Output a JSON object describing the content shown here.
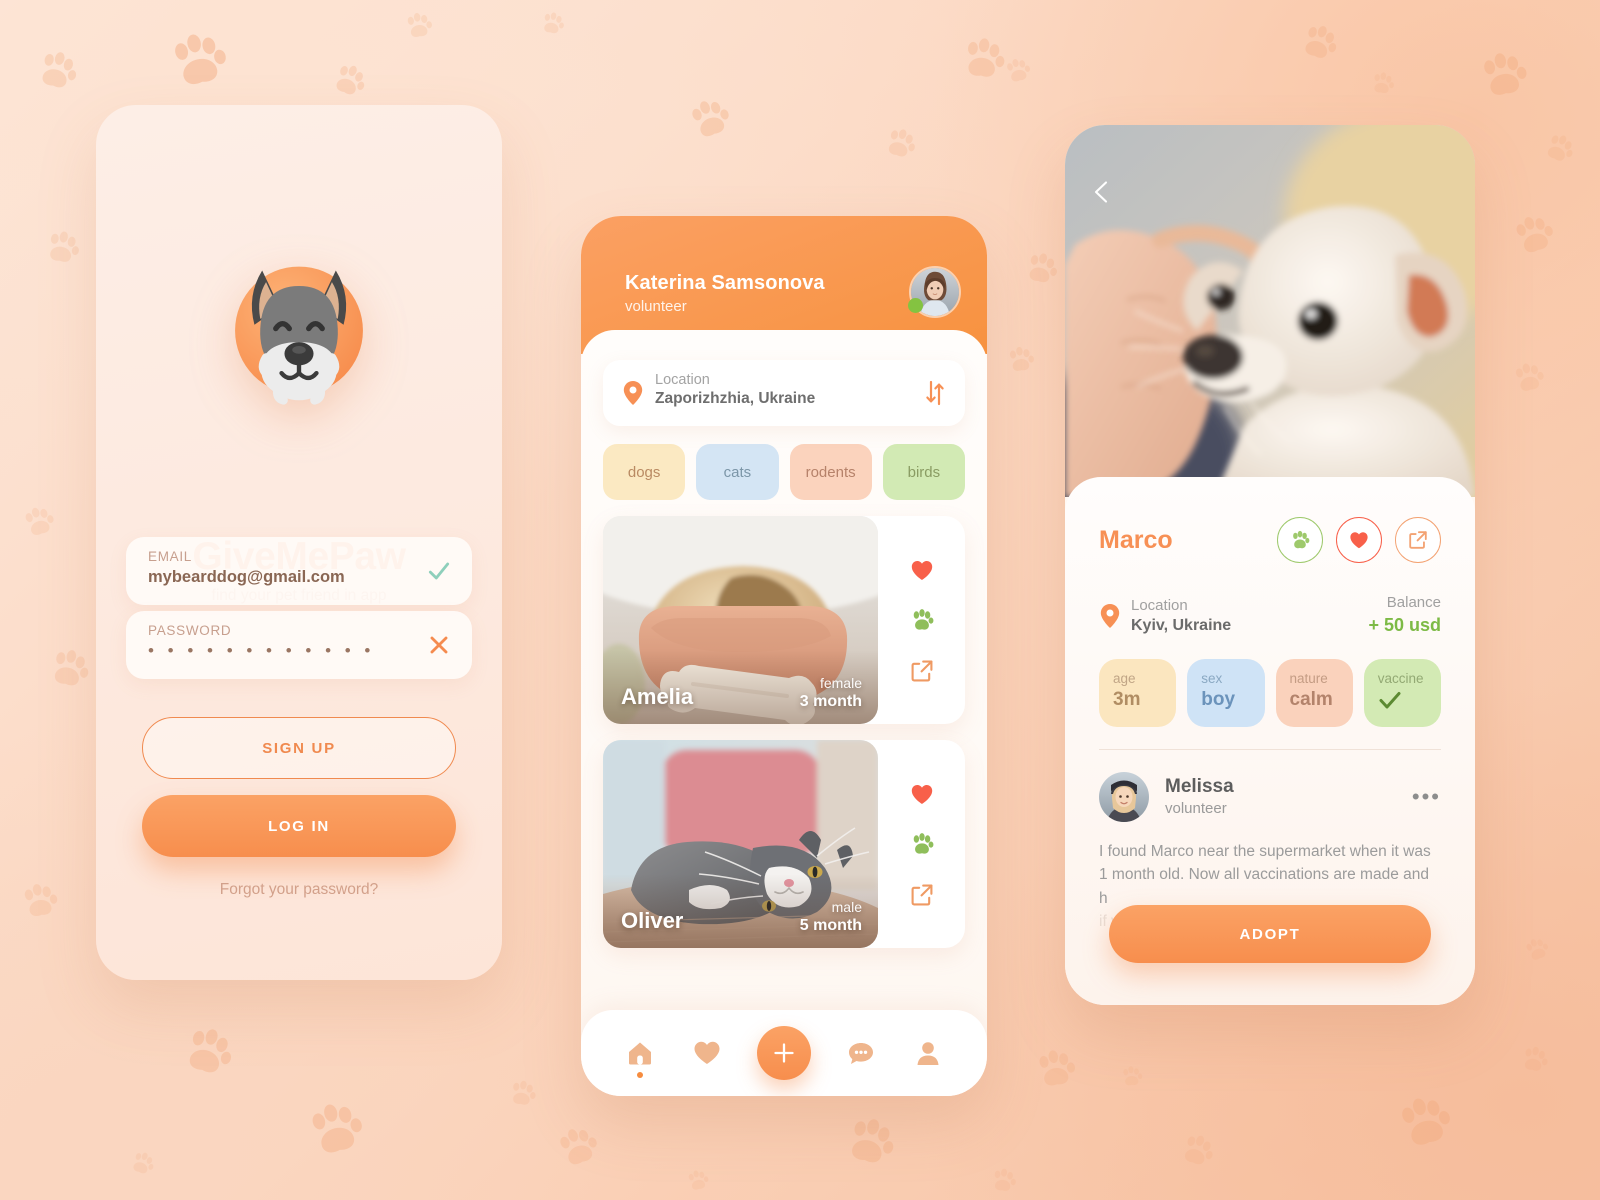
{
  "app": {
    "brand_name": "GiveMePaw",
    "tagline": "find your pet friend in app",
    "accent_color": "#f79055",
    "accent_dark": "#f78e4d",
    "background_color": "#fbd6bf"
  },
  "login_screen": {
    "logo_icon": "dog-face-logo-icon",
    "email_field": {
      "label": "EMAIL",
      "value": "mybearddog@gmail.com",
      "placeholder": "email",
      "status_icon": "check-icon",
      "status_color": "#8ecfbb"
    },
    "password_field": {
      "label": "PASSWORD",
      "value": "• • • • • • • • • • • •",
      "placeholder": "password",
      "status_icon": "close-icon",
      "status_color": "#f58b4f"
    },
    "signup_label": "SIGN UP",
    "login_label": "LOG IN",
    "forgot_label": "Forgot your password?"
  },
  "feed_screen": {
    "user": {
      "name": "Katerina Samsonova",
      "role": "volunteer",
      "online": true,
      "online_color": "#84c341"
    },
    "location": {
      "label": "Location",
      "value": "Zaporizhzhia, Ukraine",
      "pin_icon": "location-pin-icon",
      "sort_icon": "sort-filter-icon"
    },
    "categories": [
      {
        "label": "dogs",
        "bg": "#fbe9c2",
        "fg": "#b98a62"
      },
      {
        "label": "cats",
        "bg": "#d4e5f4",
        "fg": "#7c96a8"
      },
      {
        "label": "rodents",
        "bg": "#fbd3bd",
        "fg": "#b6826a"
      },
      {
        "label": "birds",
        "bg": "#d2eab4",
        "fg": "#8a9c63"
      }
    ],
    "pets": [
      {
        "name": "Amelia",
        "sex": "female",
        "age": "3 month",
        "photo": "pug-puppy-in-bowl-photo",
        "actions": [
          "heart-icon",
          "paw-icon",
          "share-icon"
        ]
      },
      {
        "name": "Oliver",
        "sex": "male",
        "age": "5 month",
        "photo": "grey-white-cat-photo",
        "actions": [
          "heart-icon",
          "paw-icon",
          "share-icon"
        ]
      }
    ],
    "tabbar": [
      {
        "icon": "home-icon",
        "label": "home",
        "active": true
      },
      {
        "icon": "heart-icon",
        "label": "favorites",
        "active": false
      },
      {
        "icon": "plus-icon",
        "label": "add",
        "active": false
      },
      {
        "icon": "chat-icon",
        "label": "messages",
        "active": false
      },
      {
        "icon": "profile-icon",
        "label": "profile",
        "active": false
      }
    ]
  },
  "detail_screen": {
    "back_icon": "chevron-left-icon",
    "hero_photo": "white-puppy-held-in-hand-photo",
    "pet_name": "Marco",
    "round_actions": [
      {
        "icon": "paw-icon",
        "color": "#9ec96c"
      },
      {
        "icon": "heart-icon",
        "color": "#f8604a"
      },
      {
        "icon": "share-icon",
        "color": "#f3a272"
      }
    ],
    "location": {
      "label": "Location",
      "value": "Kyiv, Ukraine",
      "pin_icon": "location-pin-icon"
    },
    "balance": {
      "label": "Balance",
      "value": "+ 50 usd",
      "color": "#7dba46"
    },
    "attributes": [
      {
        "label": "age",
        "value": "3m",
        "bg": "#fbe6bf",
        "fg": "#b08d63",
        "label_fg": "#c0a586"
      },
      {
        "label": "sex",
        "value": "boy",
        "bg": "#cfe3f6",
        "fg": "#6b93bb",
        "label_fg": "#8aa8c2"
      },
      {
        "label": "nature",
        "value": "calm",
        "bg": "#fad2bc",
        "fg": "#b3836b",
        "label_fg": "#c49c84"
      },
      {
        "label": "vaccine",
        "value": "",
        "bg": "#d3eab4",
        "fg": "#5c8a32",
        "label_fg": "#93a974",
        "icon": "check-icon"
      }
    ],
    "volunteer": {
      "avatar": "melissa-avatar-photo",
      "name": "Melissa",
      "role": "volunteer",
      "more_icon": "more-horizontal-icon"
    },
    "description_line1": "I found Marco near the supermarket when it was",
    "description_line2": "1 month old.  Now all vaccinations are made and",
    "description_line3": "h",
    "description_faded": "if you are not ready to become the owner of",
    "adopt_label": "ADOPT"
  },
  "background": {
    "paw_icon": "paw-print-icon",
    "paw_color": "#f3a97c"
  }
}
